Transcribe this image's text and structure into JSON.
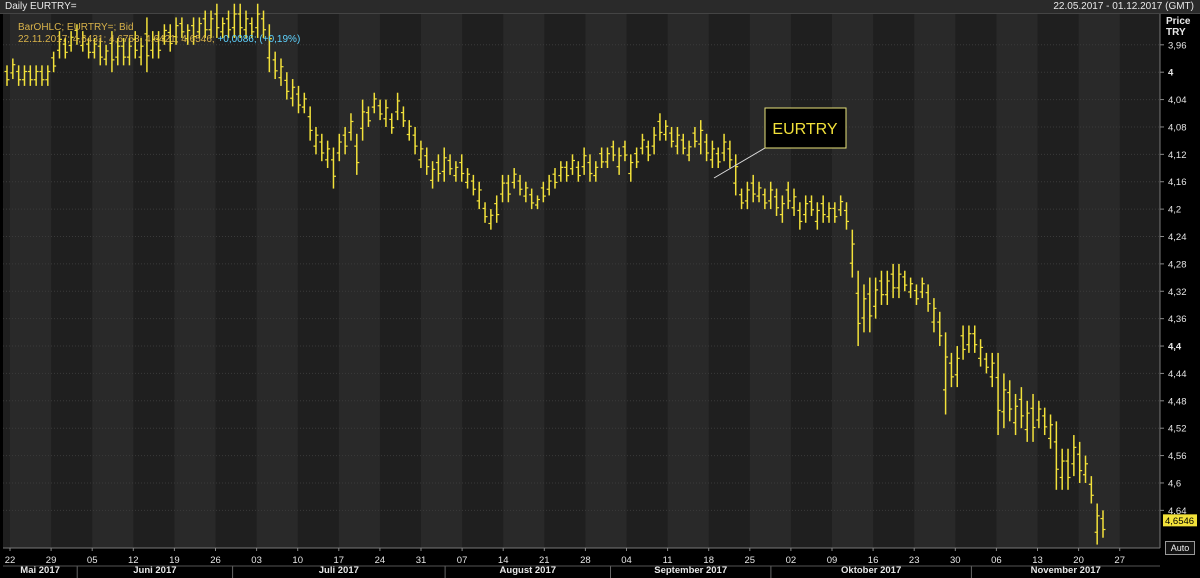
{
  "window": {
    "title": "Daily EURTRY=",
    "date_range": "22.05.2017 - 01.12.2017 (GMT)"
  },
  "legend": {
    "line1": "BarOHLC; EURTRY=; Bid",
    "line2_values": "22.11.2017; 4,6431; 4,6753; 4,6421; 4,6546;",
    "line2_change": "+0,0086; (+0,19%)"
  },
  "axis_header": {
    "line1": "Price",
    "line2": "TRY"
  },
  "auto_button": "Auto",
  "colors": {
    "background": "#1f1f1f",
    "band_alt": "#292929",
    "bar": "#f2e13a",
    "last_price_bg": "#f2e13a",
    "callout_border": "#e8e27a"
  },
  "chart_data": {
    "type": "bar",
    "subtype": "ohlc",
    "series_label": "EURTRY",
    "y_axis": {
      "ylim": [
        3.915,
        4.695
      ],
      "inverted": true,
      "ticks": [
        3.96,
        4.0,
        4.04,
        4.08,
        4.12,
        4.16,
        4.2,
        4.24,
        4.28,
        4.32,
        4.36,
        4.4,
        4.44,
        4.48,
        4.52,
        4.56,
        4.6,
        4.64
      ],
      "tick_labels": [
        "3,96",
        "4",
        "4,04",
        "4,08",
        "4,12",
        "4,16",
        "4,2",
        "4,24",
        "4,28",
        "4,32",
        "4,36",
        "4,4",
        "4,44",
        "4,48",
        "4,52",
        "4,56",
        "4,6",
        "4,64"
      ],
      "bold_ticks": [
        "4",
        "4,4"
      ],
      "last_price_label": "4,6546",
      "last_price": 4.6546
    },
    "x_axis": {
      "start_date": "22.05.2017",
      "end_date": "01.12.2017",
      "day_labels": [
        "22",
        "29",
        "05",
        "12",
        "19",
        "26",
        "03",
        "10",
        "17",
        "24",
        "31",
        "07",
        "14",
        "21",
        "28",
        "04",
        "11",
        "18",
        "25",
        "02",
        "09",
        "16",
        "23",
        "30",
        "06",
        "13",
        "20",
        "27"
      ],
      "month_labels": [
        "Mai 2017",
        "Juni 2017",
        "Juli 2017",
        "August 2017",
        "September 2017",
        "Oktober 2017",
        "November 2017"
      ]
    },
    "bars_hl": [
      [
        3.99,
        4.02
      ],
      [
        3.98,
        4.01
      ],
      [
        3.99,
        4.02
      ],
      [
        3.99,
        4.02
      ],
      [
        3.99,
        4.02
      ],
      [
        3.99,
        4.02
      ],
      [
        3.99,
        4.02
      ],
      [
        3.99,
        4.02
      ],
      [
        3.97,
        4.0
      ],
      [
        3.94,
        3.98
      ],
      [
        3.95,
        3.98
      ],
      [
        3.94,
        3.97
      ],
      [
        3.93,
        3.96
      ],
      [
        3.94,
        3.97
      ],
      [
        3.95,
        3.98
      ],
      [
        3.95,
        3.98
      ],
      [
        3.95,
        3.99
      ],
      [
        3.96,
        3.99
      ],
      [
        3.94,
        4.0
      ],
      [
        3.95,
        3.99
      ],
      [
        3.95,
        3.99
      ],
      [
        3.95,
        3.99
      ],
      [
        3.94,
        3.98
      ],
      [
        3.95,
        3.99
      ],
      [
        3.92,
        4.0
      ],
      [
        3.94,
        3.98
      ],
      [
        3.94,
        3.98
      ],
      [
        3.93,
        3.96
      ],
      [
        3.93,
        3.97
      ],
      [
        3.92,
        3.96
      ],
      [
        3.92,
        3.95
      ],
      [
        3.93,
        3.96
      ],
      [
        3.92,
        3.96
      ],
      [
        3.92,
        3.95
      ],
      [
        3.91,
        3.95
      ],
      [
        3.91,
        3.95
      ],
      [
        3.9,
        3.95
      ],
      [
        3.92,
        3.95
      ],
      [
        3.91,
        3.95
      ],
      [
        3.9,
        3.95
      ],
      [
        3.9,
        3.95
      ],
      [
        3.91,
        3.95
      ],
      [
        3.92,
        3.95
      ],
      [
        3.9,
        3.95
      ],
      [
        3.91,
        3.95
      ],
      [
        3.93,
        4.0
      ],
      [
        3.97,
        4.01
      ],
      [
        3.98,
        4.02
      ],
      [
        4.0,
        4.04
      ],
      [
        4.01,
        4.05
      ],
      [
        4.02,
        4.06
      ],
      [
        4.03,
        4.06
      ],
      [
        4.05,
        4.1
      ],
      [
        4.08,
        4.12
      ],
      [
        4.09,
        4.13
      ],
      [
        4.1,
        4.14
      ],
      [
        4.11,
        4.17
      ],
      [
        4.09,
        4.13
      ],
      [
        4.08,
        4.12
      ],
      [
        4.06,
        4.1
      ],
      [
        4.09,
        4.15
      ],
      [
        4.04,
        4.1
      ],
      [
        4.05,
        4.08
      ],
      [
        4.03,
        4.06
      ],
      [
        4.04,
        4.07
      ],
      [
        4.04,
        4.08
      ],
      [
        4.06,
        4.09
      ],
      [
        4.03,
        4.07
      ],
      [
        4.05,
        4.08
      ],
      [
        4.07,
        4.1
      ],
      [
        4.08,
        4.12
      ],
      [
        4.1,
        4.14
      ],
      [
        4.11,
        4.15
      ],
      [
        4.13,
        4.17
      ],
      [
        4.12,
        4.16
      ],
      [
        4.11,
        4.16
      ],
      [
        4.12,
        4.15
      ],
      [
        4.13,
        4.16
      ],
      [
        4.12,
        4.16
      ],
      [
        4.14,
        4.17
      ],
      [
        4.15,
        4.18
      ],
      [
        4.16,
        4.2
      ],
      [
        4.19,
        4.22
      ],
      [
        4.2,
        4.23
      ],
      [
        4.18,
        4.22
      ],
      [
        4.15,
        4.19
      ],
      [
        4.15,
        4.19
      ],
      [
        4.14,
        4.17
      ],
      [
        4.15,
        4.18
      ],
      [
        4.16,
        4.19
      ],
      [
        4.17,
        4.2
      ],
      [
        4.18,
        4.2
      ],
      [
        4.16,
        4.19
      ],
      [
        4.15,
        4.18
      ],
      [
        4.14,
        4.17
      ],
      [
        4.13,
        4.16
      ],
      [
        4.13,
        4.16
      ],
      [
        4.12,
        4.15
      ],
      [
        4.13,
        4.16
      ],
      [
        4.11,
        4.15
      ],
      [
        4.12,
        4.16
      ],
      [
        4.13,
        4.16
      ],
      [
        4.11,
        4.14
      ],
      [
        4.11,
        4.14
      ],
      [
        4.1,
        4.13
      ],
      [
        4.11,
        4.15
      ],
      [
        4.1,
        4.13
      ],
      [
        4.12,
        4.16
      ],
      [
        4.11,
        4.14
      ],
      [
        4.09,
        4.12
      ],
      [
        4.1,
        4.13
      ],
      [
        4.08,
        4.12
      ],
      [
        4.06,
        4.1
      ],
      [
        4.07,
        4.1
      ],
      [
        4.08,
        4.11
      ],
      [
        4.08,
        4.12
      ],
      [
        4.09,
        4.12
      ],
      [
        4.1,
        4.13
      ],
      [
        4.08,
        4.11
      ],
      [
        4.07,
        4.12
      ],
      [
        4.09,
        4.13
      ],
      [
        4.1,
        4.14
      ],
      [
        4.11,
        4.14
      ],
      [
        4.09,
        4.13
      ],
      [
        4.1,
        4.14
      ],
      [
        4.12,
        4.18
      ],
      [
        4.17,
        4.2
      ],
      [
        4.16,
        4.2
      ],
      [
        4.15,
        4.19
      ],
      [
        4.16,
        4.19
      ],
      [
        4.17,
        4.2
      ],
      [
        4.16,
        4.2
      ],
      [
        4.17,
        4.21
      ],
      [
        4.18,
        4.22
      ],
      [
        4.16,
        4.2
      ],
      [
        4.17,
        4.21
      ],
      [
        4.19,
        4.23
      ],
      [
        4.18,
        4.22
      ],
      [
        4.18,
        4.21
      ],
      [
        4.19,
        4.23
      ],
      [
        4.18,
        4.22
      ],
      [
        4.19,
        4.22
      ],
      [
        4.19,
        4.22
      ],
      [
        4.18,
        4.21
      ],
      [
        4.19,
        4.23
      ],
      [
        4.23,
        4.3
      ],
      [
        4.29,
        4.4
      ],
      [
        4.31,
        4.38
      ],
      [
        4.3,
        4.38
      ],
      [
        4.3,
        4.36
      ],
      [
        4.29,
        4.34
      ],
      [
        4.29,
        4.34
      ],
      [
        4.28,
        4.33
      ],
      [
        4.28,
        4.33
      ],
      [
        4.29,
        4.32
      ],
      [
        4.3,
        4.33
      ],
      [
        4.31,
        4.34
      ],
      [
        4.3,
        4.33
      ],
      [
        4.31,
        4.35
      ],
      [
        4.33,
        4.38
      ],
      [
        4.35,
        4.4
      ],
      [
        4.38,
        4.5
      ],
      [
        4.41,
        4.46
      ],
      [
        4.4,
        4.46
      ],
      [
        4.37,
        4.42
      ],
      [
        4.37,
        4.41
      ],
      [
        4.37,
        4.41
      ],
      [
        4.39,
        4.43
      ],
      [
        4.41,
        4.44
      ],
      [
        4.41,
        4.46
      ],
      [
        4.41,
        4.53
      ],
      [
        4.44,
        4.52
      ],
      [
        4.45,
        4.51
      ],
      [
        4.47,
        4.53
      ],
      [
        4.46,
        4.52
      ],
      [
        4.48,
        4.54
      ],
      [
        4.47,
        4.54
      ],
      [
        4.48,
        4.52
      ],
      [
        4.49,
        4.53
      ],
      [
        4.5,
        4.55
      ],
      [
        4.51,
        4.61
      ],
      [
        4.55,
        4.61
      ],
      [
        4.55,
        4.61
      ],
      [
        4.53,
        4.59
      ],
      [
        4.54,
        4.6
      ],
      [
        4.56,
        4.6
      ],
      [
        4.59,
        4.63
      ],
      [
        4.63,
        4.69
      ],
      [
        4.64,
        4.68
      ]
    ]
  }
}
